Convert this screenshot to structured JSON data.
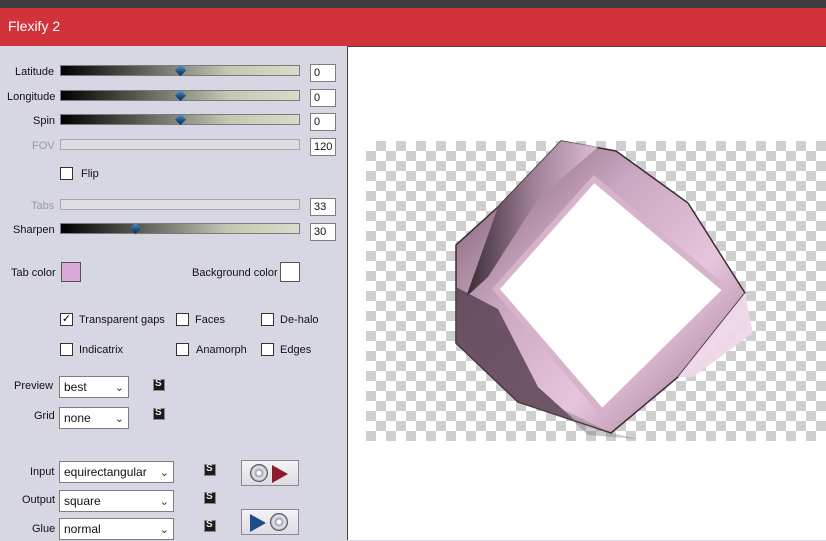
{
  "window": {
    "title": "Flexify 2"
  },
  "sliders": {
    "latitude": {
      "label": "Latitude",
      "value": "0",
      "enabled": true,
      "fraction": 0.5
    },
    "longitude": {
      "label": "Longitude",
      "value": "0",
      "enabled": true,
      "fraction": 0.5
    },
    "spin": {
      "label": "Spin",
      "value": "0",
      "enabled": true,
      "fraction": 0.5
    },
    "fov": {
      "label": "FOV",
      "value": "120",
      "enabled": false
    },
    "tabs": {
      "label": "Tabs",
      "value": "33",
      "enabled": false
    },
    "sharpen": {
      "label": "Sharpen",
      "value": "30",
      "enabled": true,
      "fraction": 0.3
    }
  },
  "flip": {
    "label": "Flip",
    "checked": false
  },
  "colors": {
    "tab_color": {
      "label": "Tab color",
      "color": "#d9a8d6"
    },
    "background_color": {
      "label": "Background color",
      "color": "#ffffff"
    }
  },
  "options": {
    "transparent_gaps": {
      "label": "Transparent gaps",
      "checked": true
    },
    "faces": {
      "label": "Faces",
      "checked": false
    },
    "de_halo": {
      "label": "De-halo",
      "checked": false
    },
    "indicatrix": {
      "label": "Indicatrix",
      "checked": false
    },
    "anamorph": {
      "label": "Anamorph",
      "checked": false
    },
    "edges": {
      "label": "Edges",
      "checked": false
    }
  },
  "preview_setting": {
    "label": "Preview",
    "value": "best"
  },
  "grid_setting": {
    "label": "Grid",
    "value": "none"
  },
  "input_setting": {
    "label": "Input",
    "value": "equirectangular"
  },
  "output_setting": {
    "label": "Output",
    "value": "square"
  },
  "glue_setting": {
    "label": "Glue",
    "value": "normal"
  },
  "icons": {
    "link": "link-icon",
    "load_preset": "disc-to-play-icon",
    "save_preset": "play-to-disc-icon",
    "dropdown": "chevron-down-icon"
  },
  "accent_colors": {
    "titlebar": "#d2333b",
    "slider_thumb": "#2a6bb0"
  }
}
